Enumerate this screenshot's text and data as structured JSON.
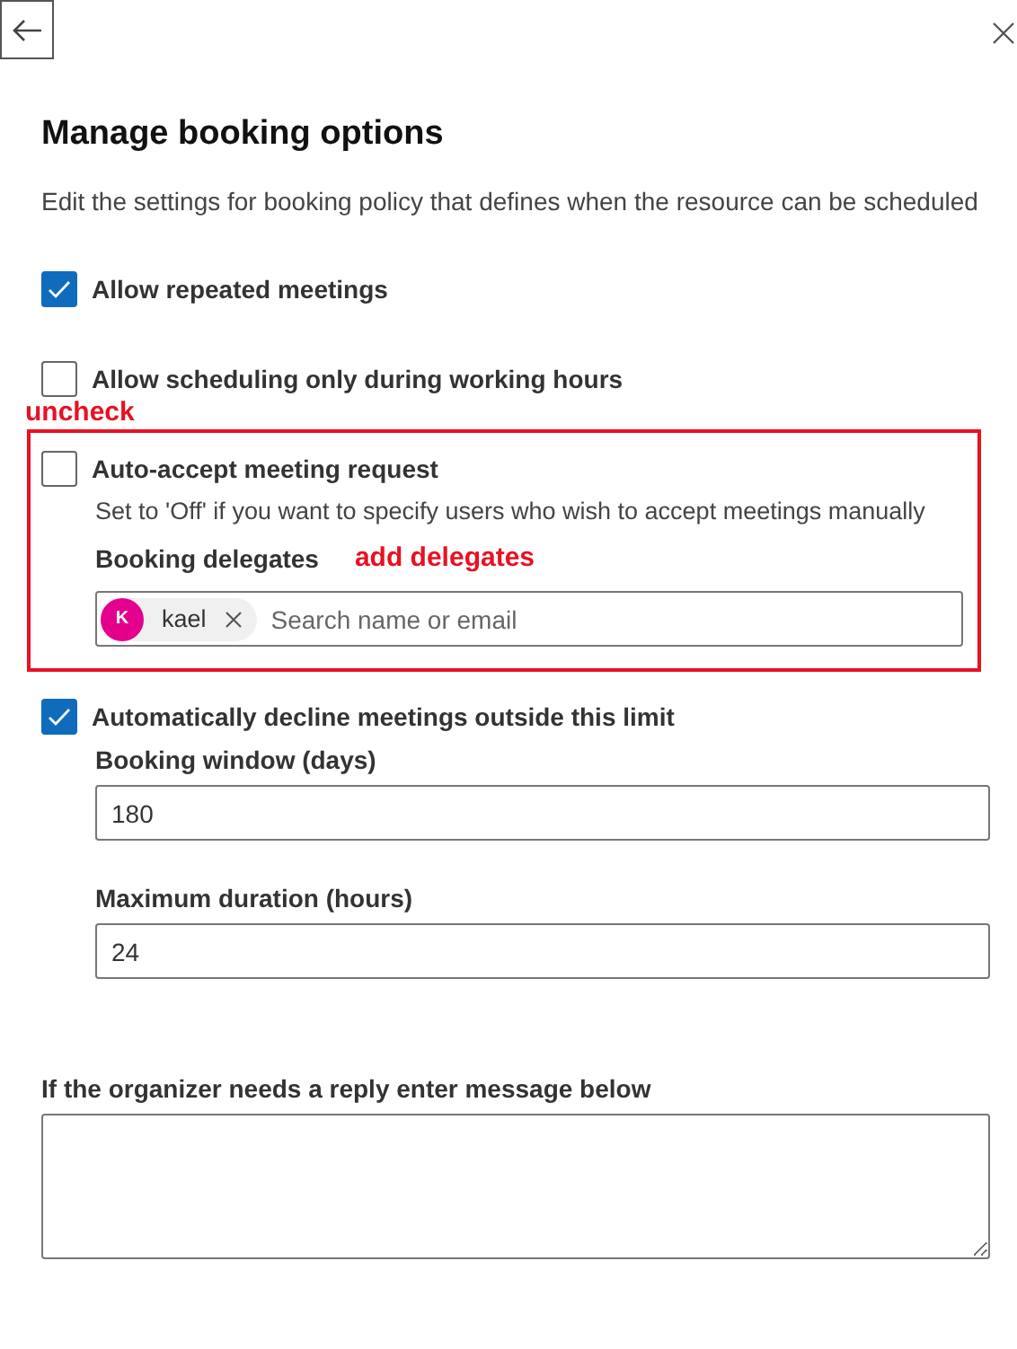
{
  "title": "Manage booking options",
  "description": "Edit the settings for booking policy that defines when the resource can be scheduled",
  "options": [
    {
      "label": "Allow repeated meetings",
      "checked": true
    },
    {
      "label": "Allow scheduling only during working hours",
      "checked": false
    }
  ],
  "auto_accept": {
    "annotation": "uncheck",
    "label": "Auto-accept meeting request",
    "checked": false,
    "hint": "Set to 'Off' if you want to specify users who wish to accept meetings manually",
    "delegates": {
      "label": "Booking delegates",
      "annotation": "add delegates",
      "chips": [
        {
          "initial": "K",
          "name": "kael",
          "color": "#e3008c"
        }
      ],
      "placeholder": "Search name or email"
    }
  },
  "decline": {
    "label": "Automatically decline meetings outside this limit",
    "checked": true,
    "fields": [
      {
        "label": "Booking window (days)",
        "value": "180"
      },
      {
        "label": "Maximum duration (hours)",
        "value": "24"
      }
    ]
  },
  "reply": {
    "label": "If the organizer needs a reply enter message below"
  }
}
